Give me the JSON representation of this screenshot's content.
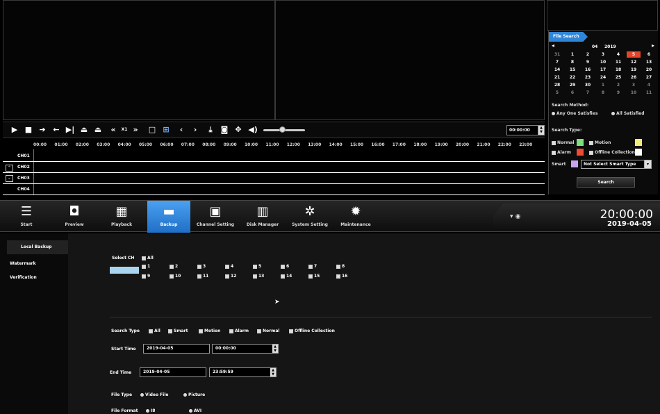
{
  "playback": {
    "time_value": "00:00:00",
    "speed_label": "X1",
    "timeline_ticks": [
      "00:00",
      "01:00",
      "02:00",
      "03:00",
      "04:00",
      "05:00",
      "06:00",
      "07:00",
      "08:00",
      "09:00",
      "10:00",
      "11:00",
      "12:00",
      "13:00",
      "14:00",
      "15:00",
      "16:00",
      "17:00",
      "18:00",
      "19:00",
      "20:00",
      "21:00",
      "22:00",
      "23:00"
    ],
    "channels": [
      "CH01",
      "CH02",
      "CH03",
      "CH04"
    ],
    "volume_fraction": 0.45
  },
  "file_search": {
    "tab_label": "File Search",
    "month": "04",
    "year": "2019",
    "calendar": [
      [
        "31",
        "1",
        "2",
        "3",
        "4",
        "5",
        "6"
      ],
      [
        "7",
        "8",
        "9",
        "10",
        "11",
        "12",
        "13"
      ],
      [
        "14",
        "15",
        "16",
        "17",
        "18",
        "19",
        "20"
      ],
      [
        "21",
        "22",
        "23",
        "24",
        "25",
        "26",
        "27"
      ],
      [
        "28",
        "29",
        "30",
        "1",
        "2",
        "3",
        "4"
      ],
      [
        "5",
        "6",
        "7",
        "8",
        "9",
        "10",
        "11"
      ]
    ],
    "selected_day": "5",
    "search_method_label": "Search Method:",
    "method_any": "Any One Satisfies",
    "method_all": "All Satisfied",
    "search_type_label": "Search Type:",
    "type_normal": "Normal",
    "type_motion": "Motion",
    "type_alarm": "Alarm",
    "type_offline": "Offline Collection",
    "smart_label": "Smart",
    "smart_value": "Not Select Smart Type",
    "search_button": "Search",
    "colors": {
      "normal": "#7ee07a",
      "motion": "#f3ec7a",
      "alarm": "#f04a34",
      "offline": "#ffffff",
      "smart": "#c9a3f0"
    }
  },
  "menu": {
    "items": [
      {
        "label": "Start",
        "icon": "menu-icon"
      },
      {
        "label": "Preview",
        "icon": "camera-icon"
      },
      {
        "label": "Playback",
        "icon": "film-icon"
      },
      {
        "label": "Backup",
        "icon": "folder-icon"
      },
      {
        "label": "Channel Setting",
        "icon": "channel-icon"
      },
      {
        "label": "Disk Manager",
        "icon": "disk-icon"
      },
      {
        "label": "System Setting",
        "icon": "system-gear-icon"
      },
      {
        "label": "Maintenance",
        "icon": "gear-icon"
      }
    ],
    "active_index": 3,
    "clock_time": "20:00:00",
    "clock_date": "2019-04-05"
  },
  "sidebar": {
    "items": [
      "Local Backup",
      "Watermark Verification"
    ]
  },
  "backup": {
    "select_ch_label": "Select CH",
    "all_label": "All",
    "channels_row1": [
      "1",
      "2",
      "3",
      "4",
      "5",
      "6",
      "7",
      "8"
    ],
    "channels_row2": [
      "9",
      "10",
      "11",
      "12",
      "13",
      "14",
      "15",
      "16"
    ],
    "search_type_label": "Search Type",
    "search_types": [
      "All",
      "Smart",
      "Motion",
      "Alarm",
      "Normal",
      "Offline Collection"
    ],
    "start_time_label": "Start Time",
    "start_date": "2019-04-05",
    "start_time": "00:00:00",
    "end_time_label": "End Time",
    "end_date": "2019-04-05",
    "end_time": "23:59:59",
    "file_type_label": "File Type",
    "file_type_video": "Video File",
    "file_type_picture": "Picture",
    "file_format_label": "File Format",
    "file_format_1": "I8",
    "file_format_2": "AVI"
  }
}
